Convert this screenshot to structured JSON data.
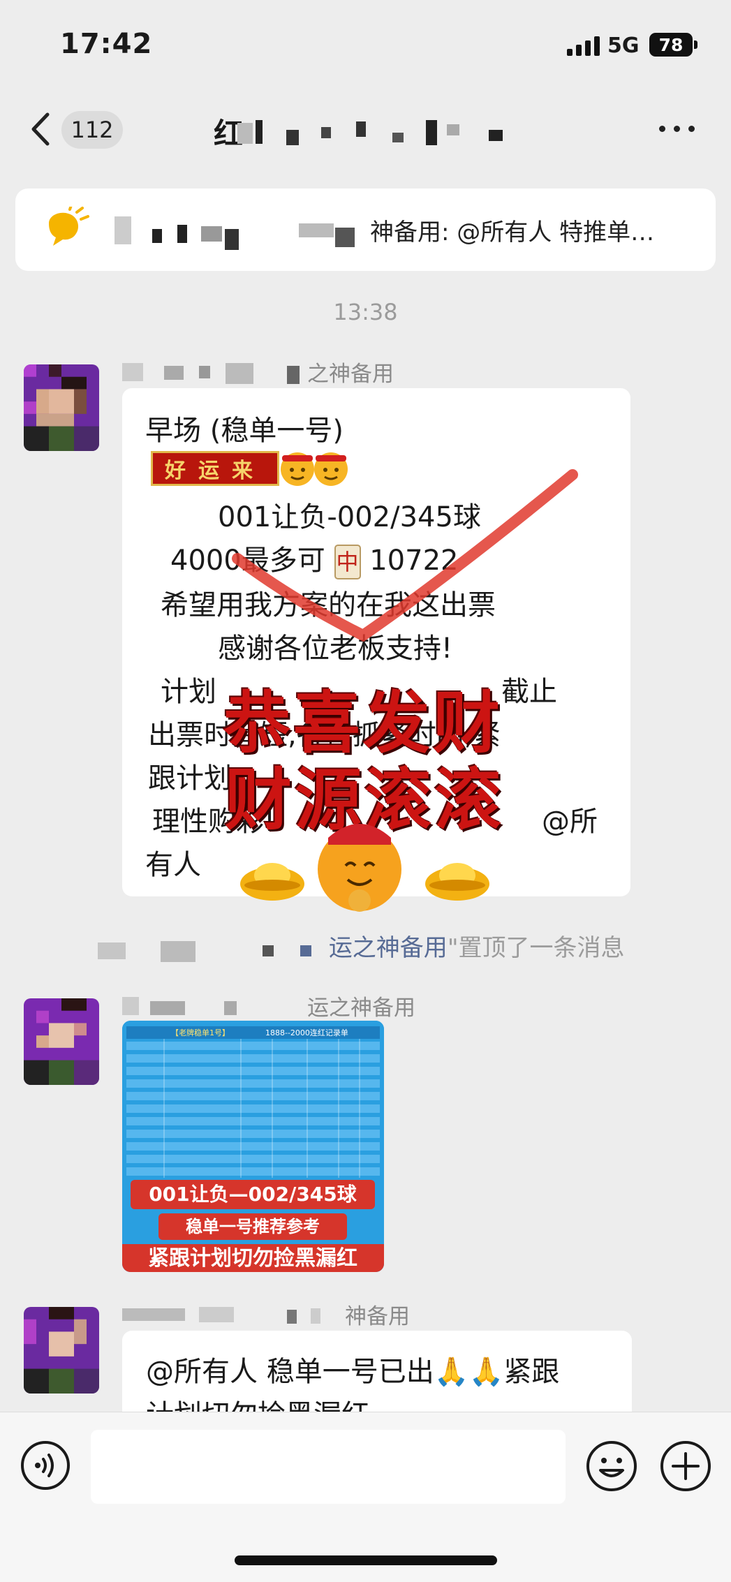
{
  "status_bar": {
    "time": "17:42",
    "network": "5G",
    "battery": "78"
  },
  "header": {
    "unread_count": "112",
    "title": "红",
    "icons": [
      "back-icon",
      "more-icon"
    ]
  },
  "pinned": {
    "text": "神备用: @所有人 特推单…",
    "icon": "announcement-icon"
  },
  "timestamp": "13:38",
  "messages": [
    {
      "sender": "之神备用",
      "lines": [
        "早场 (稳单一号)",
        "好运来",
        "001让负-002/345球",
        "4000最多可",
        "10722",
        "希望用我方案的在我这出票",
        "感谢各位老板支持!",
        "计划",
        "截止",
        "出票时间短,各位抓紧时间,紧",
        "跟计划",
        "理性购彩!",
        "@所",
        "有人"
      ],
      "mahjong_tile": "中"
    }
  ],
  "sticker": {
    "line1": "恭喜发财",
    "line2": "财源滚滚"
  },
  "system_message": {
    "name": "运之神备用",
    "text": "\"置顶了一条消息"
  },
  "image_message": {
    "sender": "运之神备用",
    "table_title": "【老牌稳单1号】",
    "table_subtitle": "1888--2000连红记录单",
    "banner1": "001让负—002/345球",
    "banner2": "稳单一号推荐参考",
    "banner3": "紧跟计划切勿捡黑漏红"
  },
  "message3": {
    "sender": "神备用",
    "line1": "@所有人 稳单一号已出",
    "line1_tail": "紧跟",
    "line2": "计划切勿捡黑漏红"
  },
  "input": {
    "placeholder": "",
    "icons": [
      "voice-icon",
      "emoji-icon",
      "plus-icon"
    ]
  },
  "colors": {
    "background": "#ededed",
    "bubble": "#ffffff",
    "link_name": "#576b95",
    "accent_red": "#cc1412"
  }
}
